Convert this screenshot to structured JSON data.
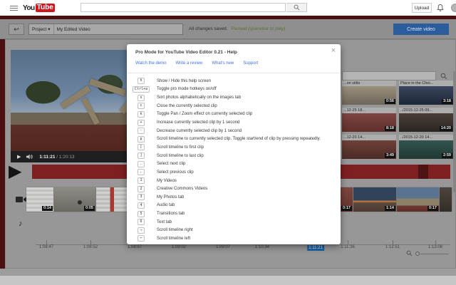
{
  "header": {
    "logo_you": "You",
    "logo_tube": "Tube",
    "search_placeholder": "",
    "upload_label": "Upload"
  },
  "toolbar": {
    "project_label": "Project",
    "video_title": "My Edited Video",
    "status_saved": "All changes saved.",
    "status_playback": "Paused (spacebar to play)",
    "create_button": "Create video"
  },
  "player": {
    "current_time": "1:11:21",
    "separator": " / ",
    "total_time": "1:20:13"
  },
  "library": {
    "tiles": [
      {
        "title": "...on stilts",
        "duration": "0:56"
      },
      {
        "title": "Place in the Choi...",
        "duration": "3:18"
      },
      {
        "title": "...12-25 18...",
        "duration": "8:18"
      },
      {
        "title": "../2015-12-25 09...",
        "duration": "14:20"
      },
      {
        "title": "...12-20 14...",
        "duration": "3:49"
      },
      {
        "title": "../2015-12-20 14...",
        "duration": "2:59"
      }
    ]
  },
  "timeline": {
    "clips": [
      {
        "duration": "0:14"
      },
      {
        "duration": "0:05"
      },
      {
        "duration": ""
      },
      {
        "duration": "0:17"
      },
      {
        "duration": "1:14"
      },
      {
        "duration": "0:17"
      },
      {
        "duration": ""
      }
    ],
    "ruler": [
      "1:08:47",
      "1:08:52",
      "1:08:57",
      "1:09:02",
      "1:09:07",
      "1:10:34",
      "1:11:21",
      "1:11:36",
      "1:12:51",
      "1:13:08"
    ],
    "playhead_index": 6,
    "playhead_time": "1:11:21"
  },
  "modal": {
    "title": "Pro Mode for YouTube Video Editor 0.21 - Help",
    "close": "×",
    "links": [
      "Watch the demo",
      "Write a review",
      "What's new",
      "Support"
    ],
    "shortcuts": [
      {
        "key": "h",
        "desc": "Show / Hide this help screen"
      },
      {
        "key": "Ctrl+a",
        "desc": "Toggle pro mode hotkeys on/off"
      },
      {
        "key": "s",
        "desc": "Sort photos alphabetically on the images tab"
      },
      {
        "key": "c",
        "desc": "Close the currently selected clip"
      },
      {
        "key": "k",
        "desc": "Toggle Pan / Zoom effect on currently selected clip"
      },
      {
        "key": "+",
        "desc": "Increase currently selected clip by 1 second"
      },
      {
        "key": "-",
        "desc": "Decrease currently selected clip by 1 second"
      },
      {
        "key": "p",
        "desc": "Scroll timeline to currently selected clip. Toggle start/end of clip by pressing repeatedly."
      },
      {
        "key": "[",
        "desc": "Scroll timeline to first clip"
      },
      {
        "key": "]",
        "desc": "Scroll timeline to last clip"
      },
      {
        "key": ".",
        "desc": "Select next clip"
      },
      {
        "key": ",",
        "desc": "Select previous clip"
      },
      {
        "key": "1",
        "desc": "My Videos"
      },
      {
        "key": "2",
        "desc": "Creative Commons Videos"
      },
      {
        "key": "3",
        "desc": "My Photos tab"
      },
      {
        "key": "4",
        "desc": "Audio tab"
      },
      {
        "key": "5",
        "desc": "Transitions tab"
      },
      {
        "key": "6",
        "desc": "Text tab"
      },
      {
        "key": "→",
        "desc": "Scroll timeline right"
      },
      {
        "key": "←",
        "desc": "Scroll timeline left"
      }
    ]
  },
  "icons": {
    "back": "↩",
    "caret_down": "▾",
    "play": "▶",
    "big_play": "▶",
    "music_note": "♪"
  },
  "colors": {
    "logo_red": "#cc181e",
    "masthead_maroon": "#4c1013",
    "create_button_blue": "#2b5c9c",
    "playhead_blue": "#1e63a4",
    "status_green": "#5a7233"
  }
}
